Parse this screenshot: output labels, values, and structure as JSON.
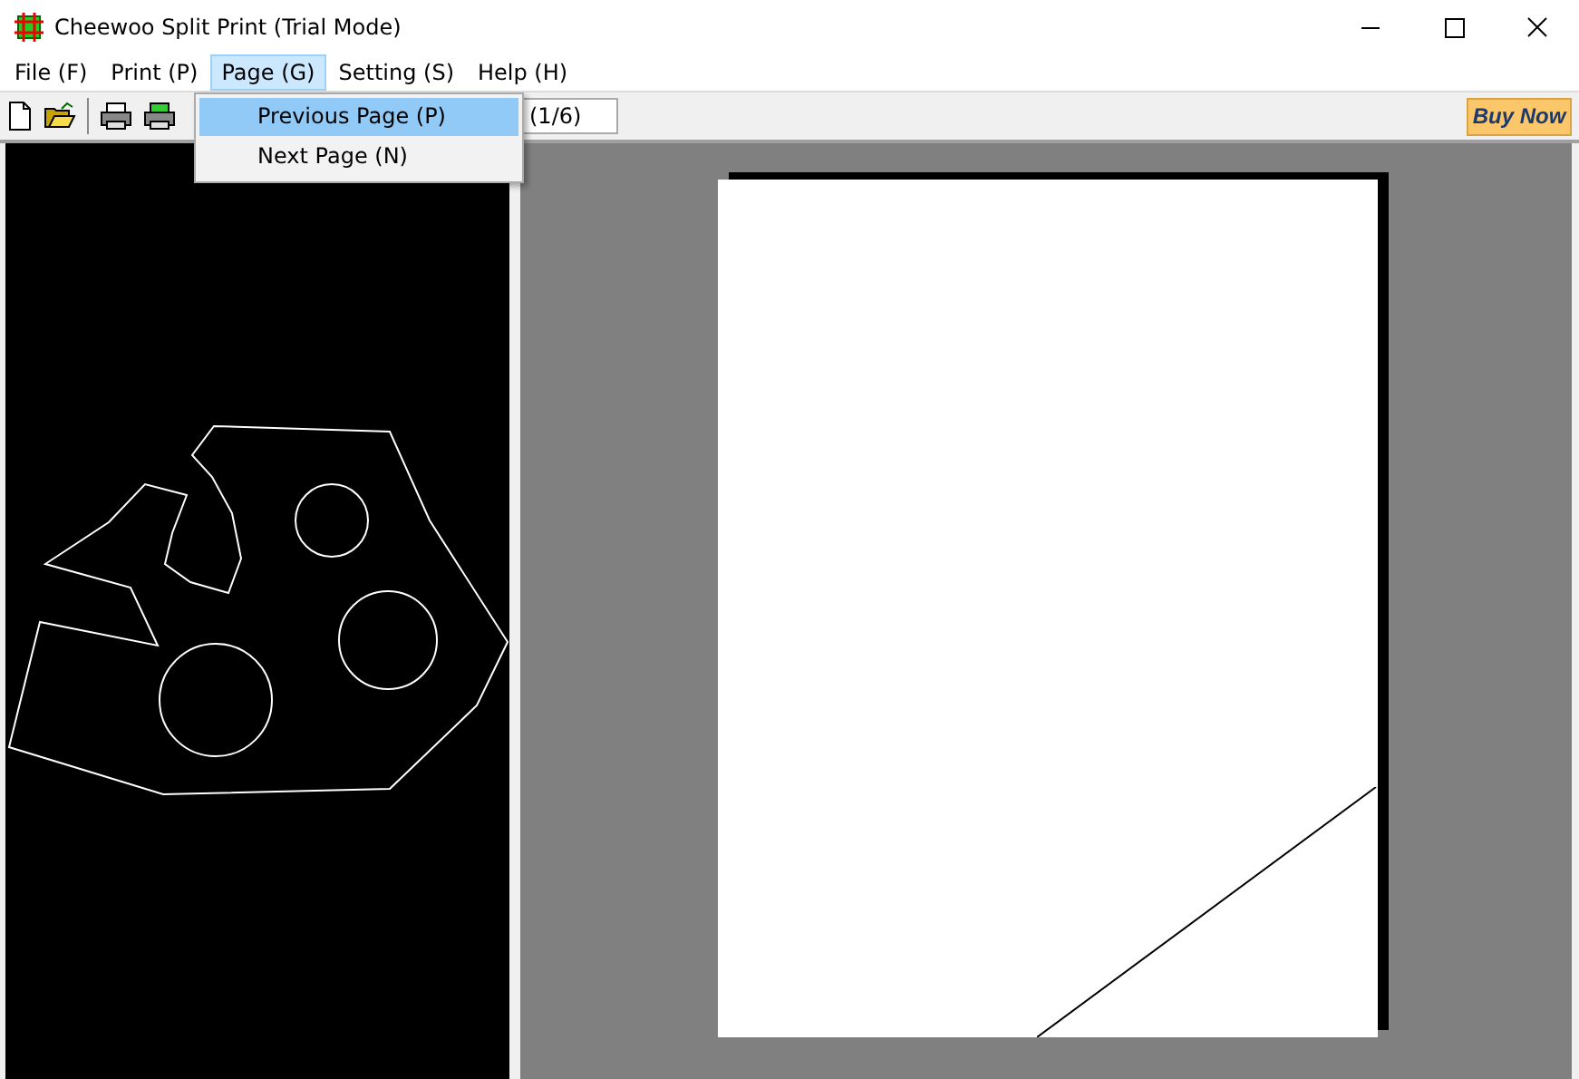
{
  "window": {
    "title": "Cheewoo Split Print (Trial Mode)"
  },
  "menu": [
    {
      "label": "File (F)",
      "selected": false
    },
    {
      "label": "Print (P)",
      "selected": false
    },
    {
      "label": "Page (G)",
      "selected": true
    },
    {
      "label": "Setting (S)",
      "selected": false
    },
    {
      "label": "Help (H)",
      "selected": false
    }
  ],
  "dropdown": [
    {
      "label": "Previous Page (P)",
      "selected": true
    },
    {
      "label": "Next Page (N)",
      "selected": false
    }
  ],
  "toolbar": {
    "page_indicator": "(1/6)",
    "buy_button": "Buy Now"
  }
}
